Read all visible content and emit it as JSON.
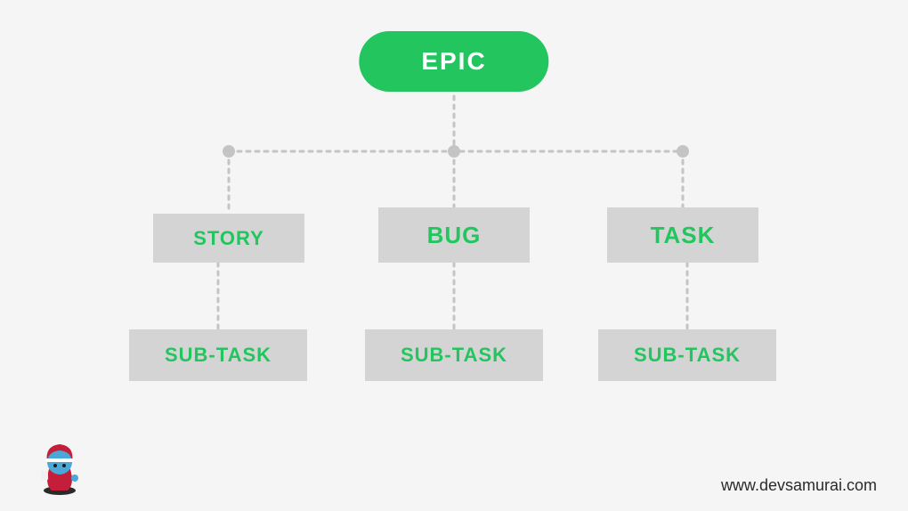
{
  "diagram": {
    "root": {
      "label": "EPIC"
    },
    "children": [
      {
        "label": "STORY",
        "sub": {
          "label": "SUB-TASK"
        }
      },
      {
        "label": "BUG",
        "sub": {
          "label": "SUB-TASK"
        }
      },
      {
        "label": "TASK",
        "sub": {
          "label": "SUB-TASK"
        }
      }
    ]
  },
  "footer": {
    "url": "www.devsamurai.com"
  },
  "colors": {
    "accent": "#22c55e",
    "box": "#d4d4d4",
    "line": "#c4c4c4"
  }
}
